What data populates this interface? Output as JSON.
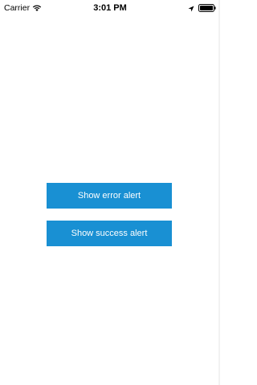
{
  "status_bar": {
    "carrier": "Carrier",
    "time": "3:01 PM",
    "icons": [
      "wifi-icon",
      "location-icon",
      "battery-icon"
    ]
  },
  "buttons": {
    "error_label": "Show error alert",
    "success_label": "Show success alert"
  },
  "colors": {
    "button_background": "#1990d3",
    "button_text": "#ffffff",
    "background": "#ffffff"
  }
}
